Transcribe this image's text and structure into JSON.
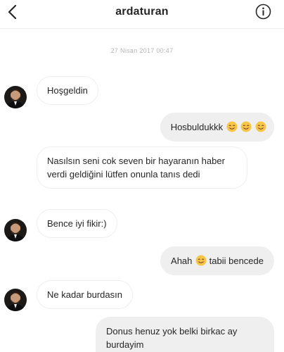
{
  "header": {
    "username": "ardaturan"
  },
  "timestamp": "27 Nisan 2017 00:47",
  "messages": [
    {
      "from": "them",
      "text": "Hoşgeldin"
    },
    {
      "from": "me",
      "text": "Hosbuldukkk",
      "emoji_after": "smiling-face x3"
    },
    {
      "from": "them",
      "text": "Nasılsın seni cok seven bir hayaranın haber verdi geldiğini lütfen onunla tanıs dedi"
    },
    {
      "from": "them",
      "text": "Bence iyi fikir:)"
    },
    {
      "from": "me",
      "text_before": "Ahah",
      "text_after": "tabii bencede",
      "emoji": "smiling-face"
    },
    {
      "from": "them",
      "text": "Ne kadar burdasın"
    },
    {
      "from": "me",
      "text": "Donus henuz yok  belki birkac ay burdayim"
    }
  ],
  "icons": {
    "back": "chevron-left-icon",
    "info": "info-icon",
    "emoji": "smiling-face-emoji"
  },
  "colors": {
    "text": "#262626",
    "outgoing_bubble": "#efefef",
    "incoming_border": "#efefef",
    "timestamp": "#b5b5b5",
    "emoji": "#f7c648"
  }
}
